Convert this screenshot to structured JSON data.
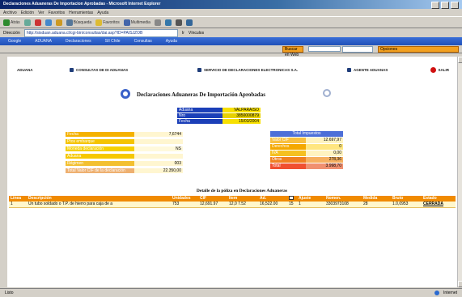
{
  "window": {
    "title": "Declaraciones Aduaneras De Importacion Aprobadas - Microsoft Internet Explorer"
  },
  "menubar": {
    "items": [
      "Archivo",
      "Edición",
      "Ver",
      "Favoritos",
      "Herramientas",
      "Ayuda"
    ]
  },
  "toolbar": {
    "back": "Atrás",
    "search": "Búsqueda",
    "favorites": "Favoritos",
    "media": "Multimedia"
  },
  "address": {
    "label": "Dirección",
    "url": "http://sisduan.aduana.cl/cgi-bin/consultas/dai.asp?ID=PAISJZOB",
    "go": "Ir",
    "links": "Vínculos"
  },
  "linkbar": {
    "items": [
      "Google",
      "ADUANA",
      "Declaraciones",
      "SII Chile",
      "Consultas",
      "Ayuda"
    ]
  },
  "searchbar": {
    "button1": "Buscar en Web",
    "button2": "Opciones"
  },
  "page": {
    "brand": "ADUANA",
    "nav": [
      {
        "label": "CONSULTAS DE DI ADUANAS",
        "icon": "folder-icon"
      },
      {
        "label": "SERVICIO DE DECLARACIONES ELECTRONICAS S.A.",
        "icon": "folder-icon"
      },
      {
        "label": "AGENTE ADUANAS",
        "icon": "folder-icon"
      }
    ],
    "logout": "SALIR",
    "title": "Declaraciones Aduaneras De Importación Aprobadas",
    "info": [
      {
        "label": "Aduana",
        "value": "VALPARAISO"
      },
      {
        "label": "Nro",
        "value": "3850000879"
      },
      {
        "label": "Fecha",
        "value": "15/03/2004"
      }
    ],
    "form": [
      {
        "label": "Fecha",
        "value": "7,6744",
        "color": "#f5b200"
      },
      {
        "label": "Ptos embarque",
        "value": "",
        "color": "#f5c400"
      },
      {
        "label": "Moneda declaración",
        "value": "NS",
        "color": "#f5d000"
      },
      {
        "label": "Aduana",
        "value": "",
        "color": "#f6c800"
      },
      {
        "label": "Régimen",
        "value": "003",
        "color": "#f3c030"
      },
      {
        "label": "Total Valor CIF de la declaración",
        "value": "22.350,00",
        "color": "#eeb070"
      }
    ],
    "totals": {
      "header": "Total Impuestos",
      "rows": [
        {
          "label": "Valor CIF",
          "value": "12.697,97",
          "color": "#f8c040",
          "bg": "#fff3c0"
        },
        {
          "label": "Derechos",
          "value": "0",
          "color": "#f4a800",
          "bg": "#ffe680"
        },
        {
          "label": "IVA",
          "value": "0,00",
          "color": "#f5c020",
          "bg": "#fff3c0"
        },
        {
          "label": "Otros",
          "value": "278,36",
          "color": "#f08020",
          "bg": "#f6b060"
        },
        {
          "label": "Total",
          "value": "3.998,70",
          "color": "#f05030",
          "bg": "#f09070"
        }
      ]
    },
    "detail": {
      "title": "Detalle de la póliza en Declaraciones Aduaneras",
      "columns": [
        "Línea",
        "Descripción",
        "Unidades",
        "CIF",
        "Ítem",
        "Ad.",
        "",
        "Ajuste",
        "Nomen.",
        "Medida",
        "Bruto",
        "Estado"
      ],
      "rows": [
        [
          "1",
          "Un tubo soldado o T.P. de hierro para caja de a",
          "753",
          "12,691.97",
          "12,0 7.52",
          "16,522.00",
          "15",
          "1",
          "3303973108",
          "28",
          "1.0,0953",
          "CERRADA"
        ]
      ]
    }
  },
  "status": {
    "left": "Listo",
    "right": "Internet"
  }
}
